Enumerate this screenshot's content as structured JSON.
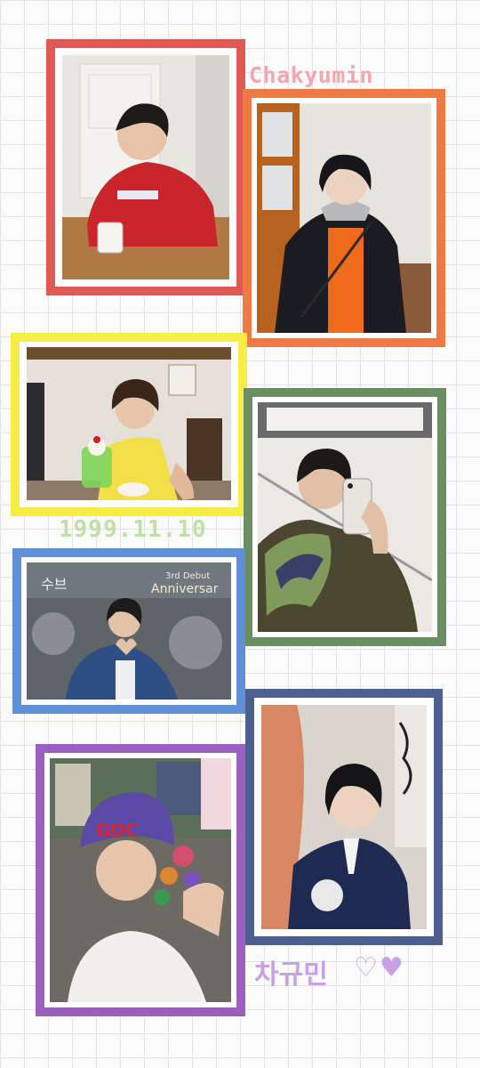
{
  "title": "Chakyumin",
  "birthdate": "1999.11.10",
  "korean_name": "차규민",
  "hearts": "♡♥",
  "colors": {
    "background": "#fbfbfb",
    "grid": "#e3e3e3",
    "title": "#f3a6ae",
    "date": "#bfe0a8",
    "korean_name": "#c9a0e6"
  },
  "frames": [
    {
      "id": "red",
      "color": "#e05a55",
      "subject": "red sweatshirt at cafe table"
    },
    {
      "id": "orange",
      "color": "#f07a43",
      "subject": "black coat and orange zip-up"
    },
    {
      "id": "yellow",
      "color": "#f6ee45",
      "subject": "yellow tank top with melon soda"
    },
    {
      "id": "green",
      "color": "#6b8f62",
      "subject": "mirror selfie with striped scarf"
    },
    {
      "id": "blue",
      "color": "#5f8fd6",
      "subject": "heart hands in blue jacket"
    },
    {
      "id": "navy",
      "color": "#4c5f8e",
      "subject": "navy varsity cardigan"
    },
    {
      "id": "purple",
      "color": "#9b5fc0",
      "subject": "purple beanie with gummy candies"
    }
  ],
  "sign_text": {
    "debut": "3rd Debut",
    "anniversary": "Anniversar",
    "shop": "수브",
    "beanie": "GDC"
  }
}
